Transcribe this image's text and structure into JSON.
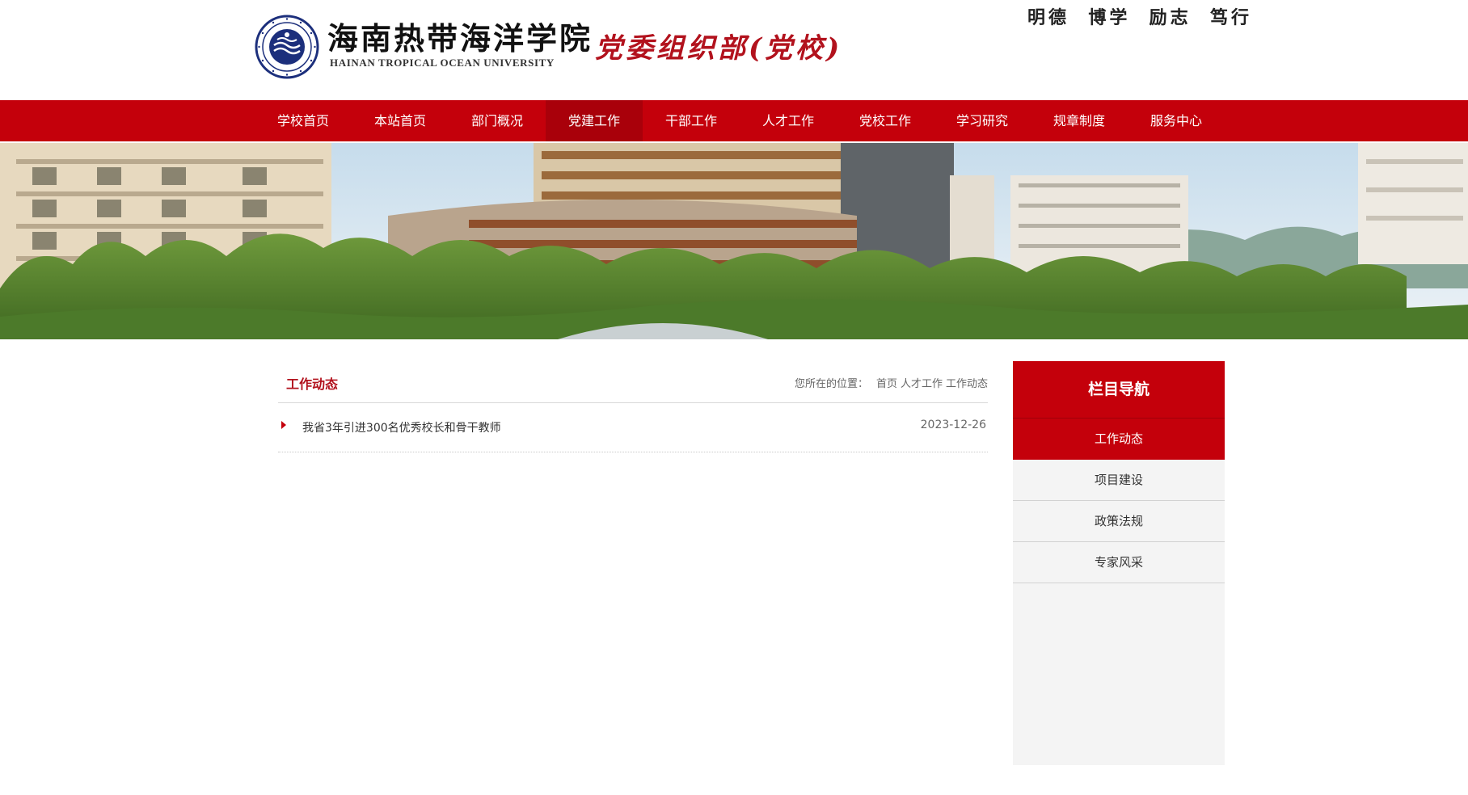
{
  "header": {
    "school_cn": "海南热带海洋学院",
    "school_en": "HAINAN TROPICAL OCEAN UNIVERSITY",
    "department": "党委组织部(党校)",
    "motto": "明德  博学  励志  笃行",
    "logo_icon": "university-seal-icon"
  },
  "nav": {
    "items": [
      {
        "label": "学校首页"
      },
      {
        "label": "本站首页"
      },
      {
        "label": "部门概况"
      },
      {
        "label": "党建工作"
      },
      {
        "label": "干部工作"
      },
      {
        "label": "人才工作"
      },
      {
        "label": "党校工作"
      },
      {
        "label": "学习研究"
      },
      {
        "label": "规章制度"
      },
      {
        "label": "服务中心"
      }
    ],
    "active_index": 3
  },
  "main": {
    "title": "工作动态",
    "breadcrumb": {
      "label": "您所在的位置：",
      "items": [
        "首页",
        "人才工作",
        "工作动态"
      ]
    },
    "articles": [
      {
        "title": "我省3年引进300名优秀校长和骨干教师",
        "date": "2023-12-26"
      }
    ]
  },
  "sidebar": {
    "title": "栏目导航",
    "items": [
      {
        "label": "工作动态"
      },
      {
        "label": "项目建设"
      },
      {
        "label": "政策法规"
      },
      {
        "label": "专家风采"
      }
    ],
    "active_index": 0
  },
  "colors": {
    "brand_red": "#c4000b",
    "title_red": "#b2121d",
    "logo_blue": "#1c2f7c"
  }
}
